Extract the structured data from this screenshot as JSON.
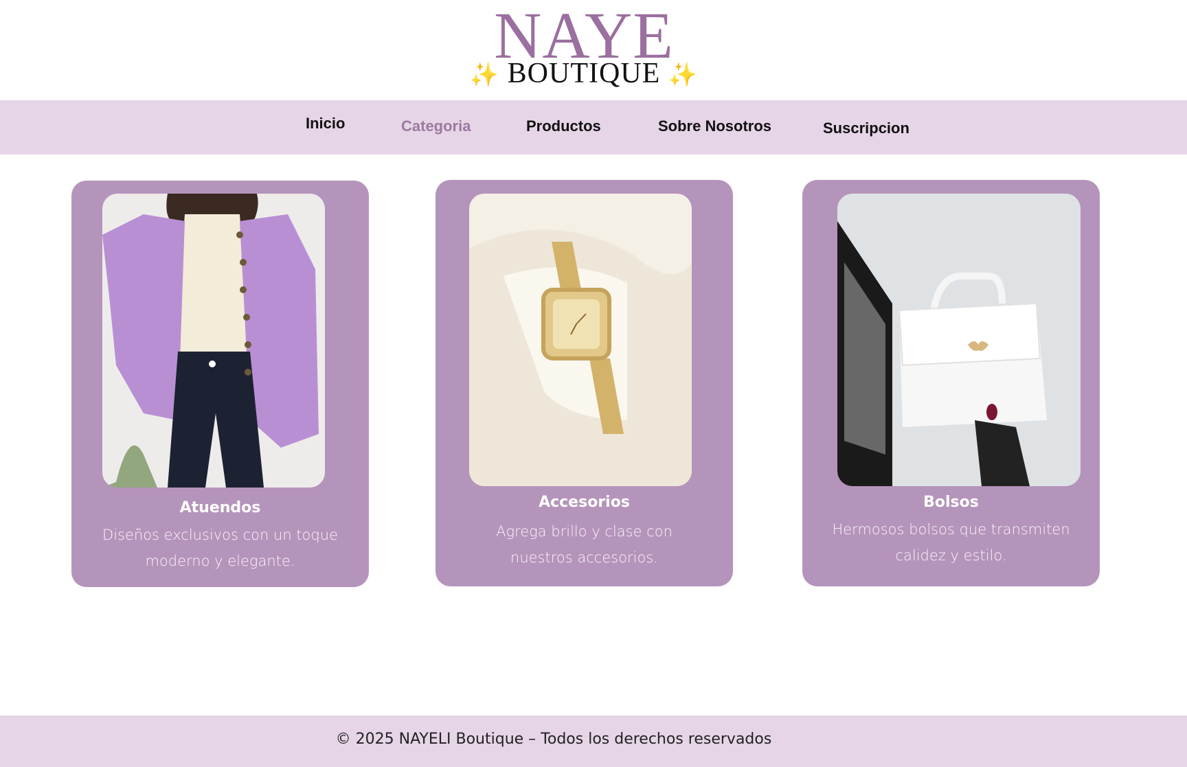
{
  "brand": {
    "name": "NAYE",
    "subtitle": "BOUTIQUE",
    "sparkle_left": "✨",
    "sparkle_right": "✨",
    "primary_color": "#9b6f9f"
  },
  "nav": {
    "items": [
      {
        "label": "Inicio",
        "active": false
      },
      {
        "label": "Categoria",
        "active": true
      },
      {
        "label": "Productos",
        "active": false
      },
      {
        "label": "Sobre Nosotros",
        "active": false
      },
      {
        "label": "Suscripcion",
        "active": false
      }
    ],
    "background": "#e6d5e7"
  },
  "categories": [
    {
      "title": "Atuendos",
      "description": "Diseños exclusivos con un toque moderno y elegante.",
      "image": "purple-denim-jacket-photo"
    },
    {
      "title": "Accesorios",
      "description": "Agrega brillo y clase con nuestros accesorios.",
      "image": "gold-watch-photo"
    },
    {
      "title": "Bolsos",
      "description": "Hermosos bolsos que transmiten calidez y estilo.",
      "image": "white-handbag-photo"
    }
  ],
  "card_color": "#b594bb",
  "footer": {
    "text": "© 2025 NAYELI Boutique – Todos los derechos reservados"
  }
}
